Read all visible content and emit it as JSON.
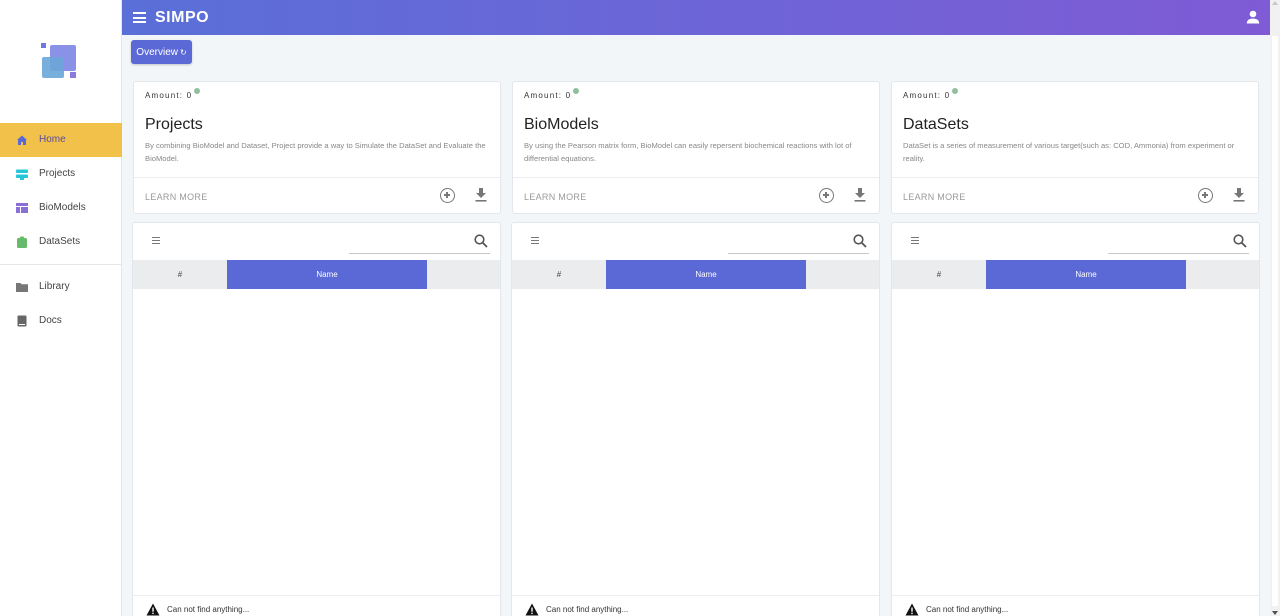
{
  "app": {
    "title": "SIMPO"
  },
  "sidebar": {
    "items": [
      {
        "label": "Home",
        "icon": "home-icon"
      },
      {
        "label": "Projects",
        "icon": "projects-icon"
      },
      {
        "label": "BioModels",
        "icon": "biomodels-icon"
      },
      {
        "label": "DataSets",
        "icon": "datasets-icon"
      },
      {
        "label": "Library",
        "icon": "folder-icon"
      },
      {
        "label": "Docs",
        "icon": "book-icon"
      }
    ]
  },
  "toolbar": {
    "overview_label": "Overview",
    "overview_icon": "refresh-icon"
  },
  "cards": [
    {
      "amount": "Amount: 0",
      "title": "Projects",
      "desc": "By combining BioModel and Dataset, Project provide a way to Simulate the DataSet and Evaluate the BioModel.",
      "learn": "LEARN MORE"
    },
    {
      "amount": "Amount: 0",
      "title": "BioModels",
      "desc": "By using the Pearson matrix form, BioModel can easily repersent biochemical reactions with lot of differential equations.",
      "learn": "LEARN MORE"
    },
    {
      "amount": "Amount: 0",
      "title": "DataSets",
      "desc": "DataSet is a series of measurement of various target(such as: COD, Ammonia) from experiment or reality.",
      "learn": "LEARN MORE"
    }
  ],
  "tables": [
    {
      "col_hash": "#",
      "col_name": "Name",
      "empty": "Can not find anything..."
    },
    {
      "col_hash": "#",
      "col_name": "Name",
      "empty": "Can not find anything..."
    },
    {
      "col_hash": "#",
      "col_name": "Name",
      "empty": "Can not find anything..."
    }
  ],
  "colors": {
    "accent": "#5b69d6",
    "active_nav": "#f1c14a",
    "header_start": "#5a6fd8",
    "header_end": "#7f5bd6"
  }
}
